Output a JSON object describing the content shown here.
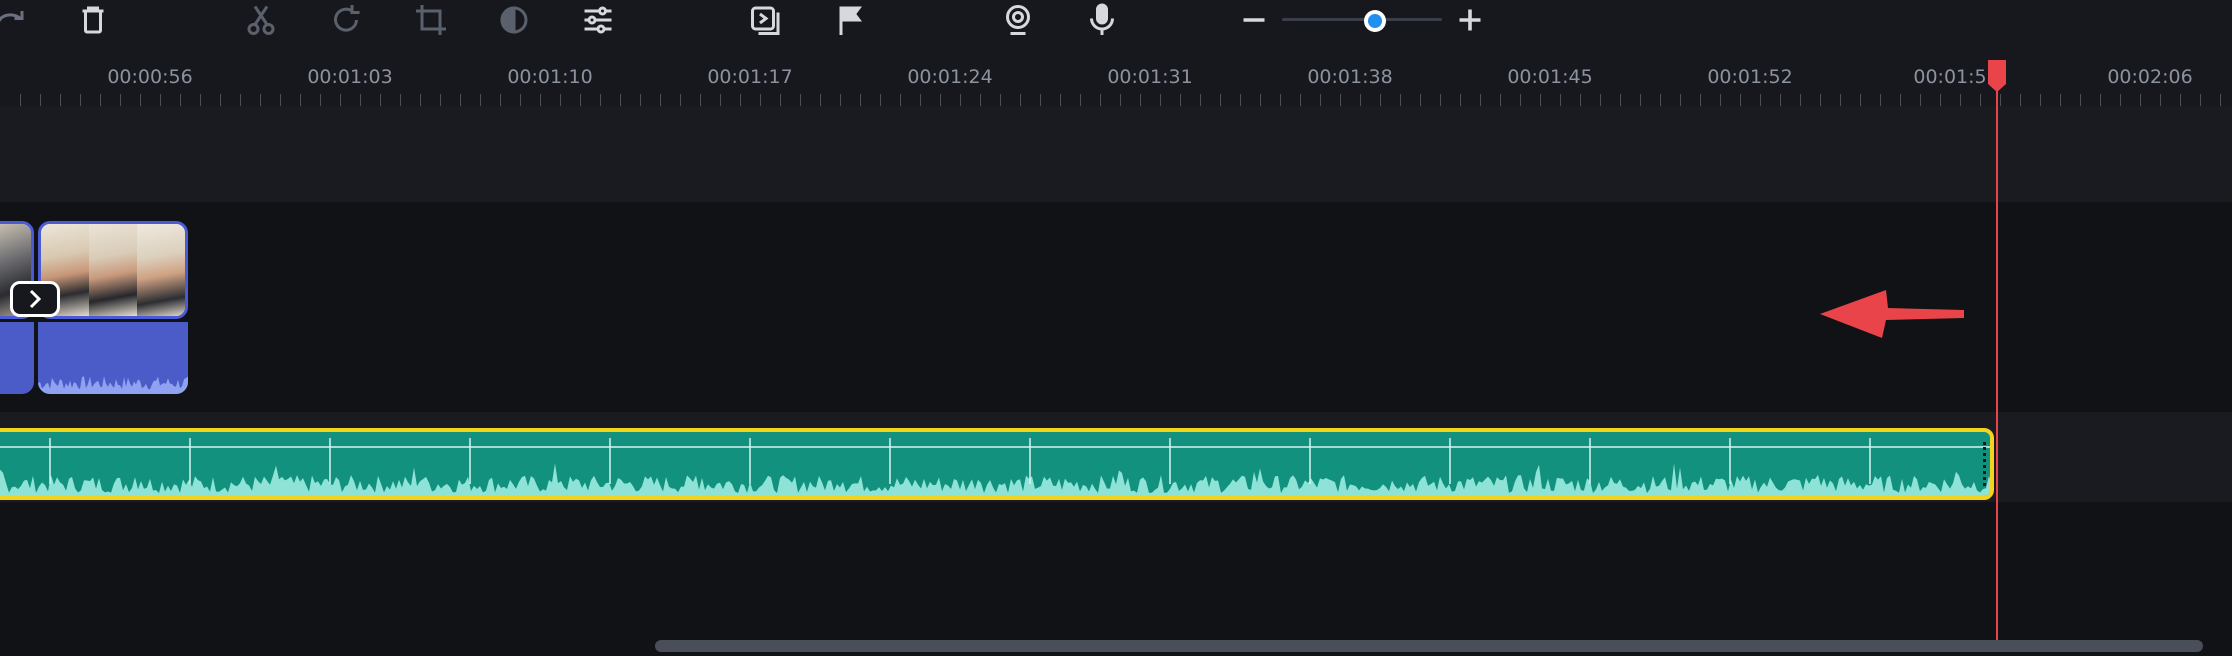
{
  "toolbar": {
    "icons": [
      "redo-icon",
      "trash-icon",
      "cut-icon",
      "rotate-icon",
      "crop-icon",
      "color-adjust-icon",
      "settings-sliders-icon",
      "clip-properties-icon",
      "marker-flag-icon",
      "webcam-record-icon",
      "microphone-icon",
      "zoom-out-icon",
      "zoom-in-icon"
    ],
    "zoom_level": 0.58
  },
  "ruler": {
    "labels": [
      "00:00:56",
      "00:01:03",
      "00:01:10",
      "00:01:17",
      "00:01:24",
      "00:01:31",
      "00:01:38",
      "00:01:45",
      "00:01:52",
      "00:01:5",
      "00:02:06"
    ]
  },
  "colors": {
    "playhead": "#e8444a",
    "audio_clip_fill": "#12917f",
    "audio_clip_border": "#f4d31e",
    "video_clip_border": "#4b5bd6",
    "annotation_arrow": "#e8444a"
  }
}
